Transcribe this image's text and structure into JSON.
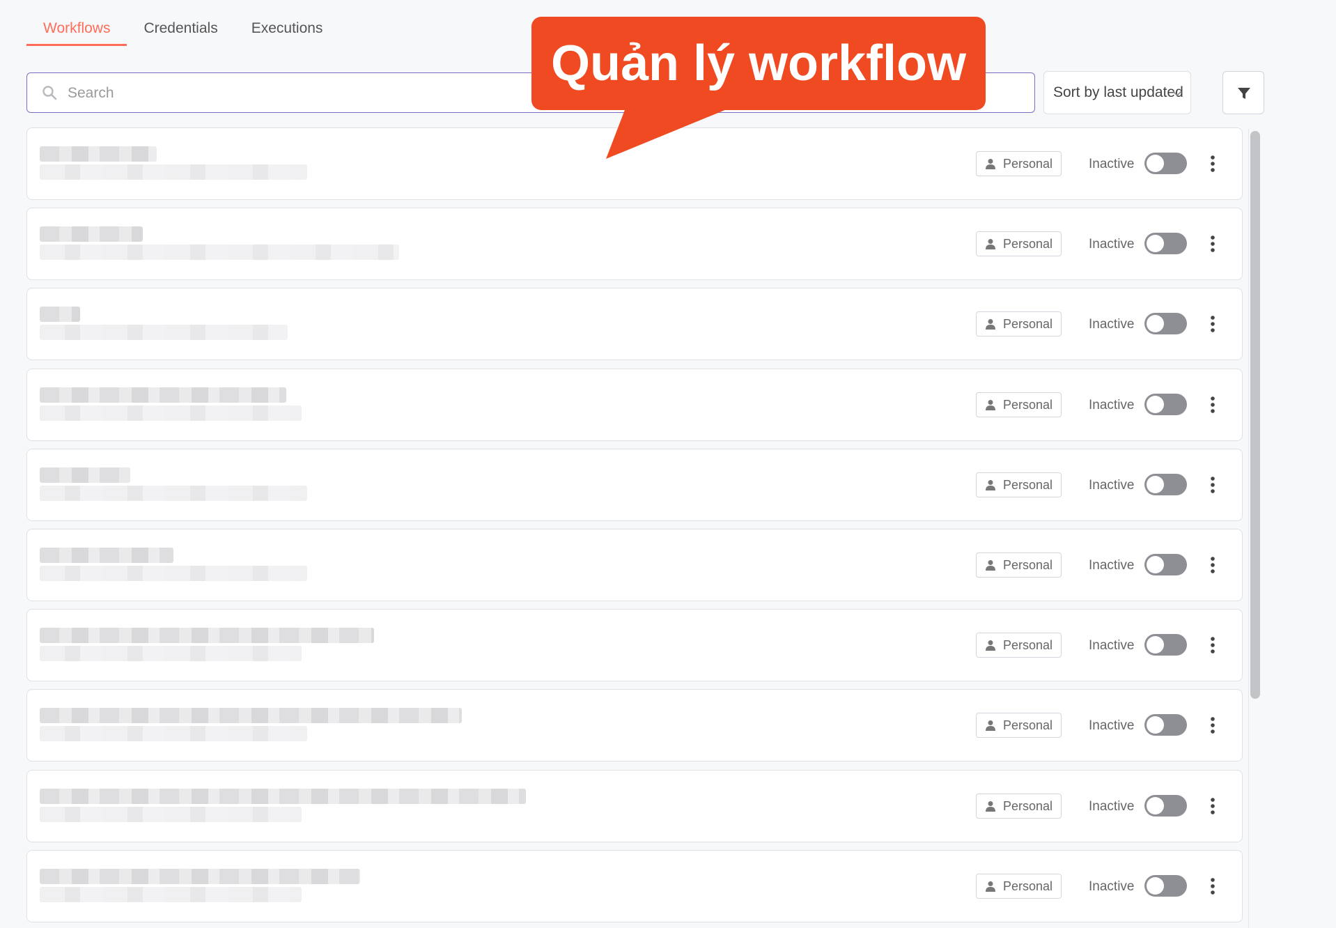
{
  "tabs": [
    {
      "label": "Workflows",
      "active": true
    },
    {
      "label": "Credentials",
      "active": false
    },
    {
      "label": "Executions",
      "active": false
    }
  ],
  "search": {
    "placeholder": "Search",
    "value": ""
  },
  "sort": {
    "selected": "Sort by last updated"
  },
  "callout": {
    "text": "Quản lý workflow"
  },
  "workflows": [
    {
      "owner": "Personal",
      "status": "Inactive"
    },
    {
      "owner": "Personal",
      "status": "Inactive"
    },
    {
      "owner": "Personal",
      "status": "Inactive"
    },
    {
      "owner": "Personal",
      "status": "Inactive"
    },
    {
      "owner": "Personal",
      "status": "Inactive"
    },
    {
      "owner": "Personal",
      "status": "Inactive"
    },
    {
      "owner": "Personal",
      "status": "Inactive"
    },
    {
      "owner": "Personal",
      "status": "Inactive"
    },
    {
      "owner": "Personal",
      "status": "Inactive"
    },
    {
      "owner": "Personal",
      "status": "Inactive"
    }
  ],
  "colors": {
    "accent": "#ff6d5a",
    "callout": "#f04a22",
    "search_border": "#7b6bc7",
    "toggle_off": "#8d8f94"
  },
  "icons": {
    "search": "search-icon",
    "sort_chevron": "chevron-down-icon",
    "filter": "filter-icon",
    "owner": "user-icon",
    "more": "more-vertical-icon"
  }
}
